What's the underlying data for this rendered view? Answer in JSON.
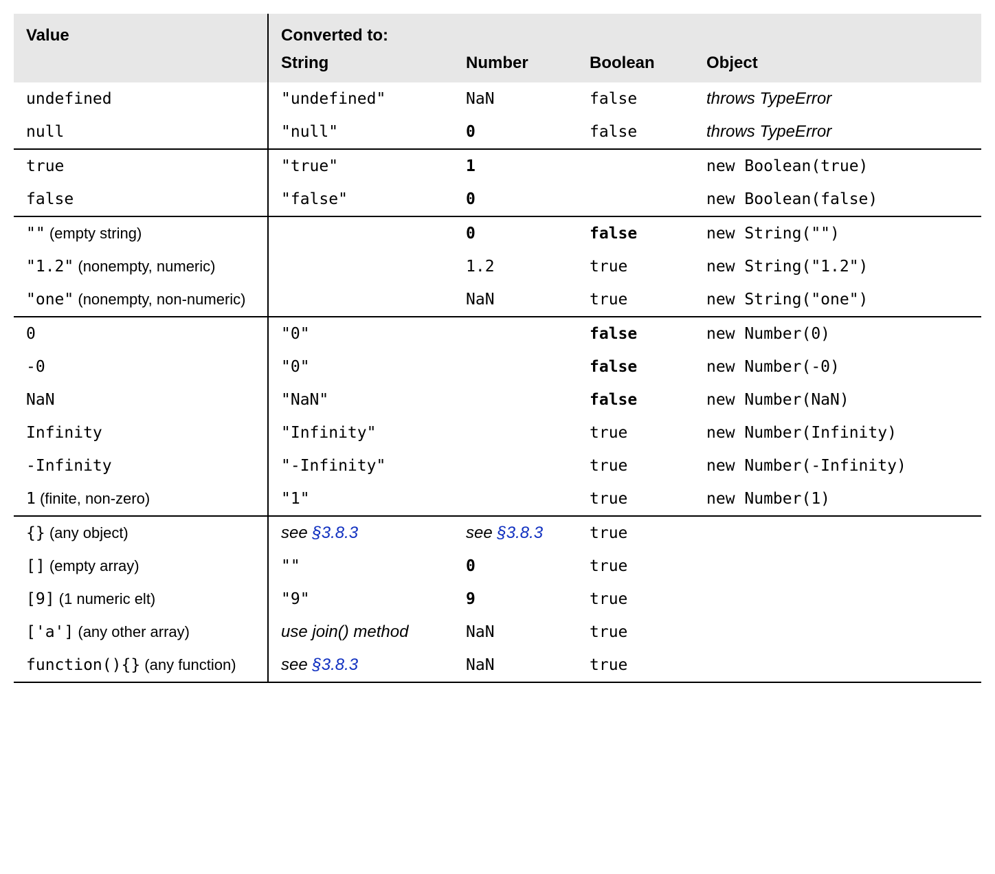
{
  "headers": {
    "value": "Value",
    "converted_to": "Converted to:",
    "string": "String",
    "number": "Number",
    "boolean": "Boolean",
    "object": "Object"
  },
  "groups": [
    {
      "rows": [
        {
          "value_code": "undefined",
          "value_note": "",
          "string": {
            "text": "\"undefined\"",
            "style": "mono"
          },
          "number": {
            "text": "NaN",
            "style": "mono"
          },
          "boolean": {
            "text": "false",
            "style": "mono"
          },
          "object": {
            "text": "throws TypeError",
            "style": "ital sans"
          }
        },
        {
          "value_code": "null",
          "value_note": "",
          "string": {
            "text": "\"null\"",
            "style": "mono"
          },
          "number": {
            "text": "0",
            "style": "mono bold"
          },
          "boolean": {
            "text": "false",
            "style": "mono"
          },
          "object": {
            "text": "throws TypeError",
            "style": "ital sans"
          }
        }
      ]
    },
    {
      "rows": [
        {
          "value_code": "true",
          "value_note": "",
          "string": {
            "text": "\"true\"",
            "style": "mono"
          },
          "number": {
            "text": "1",
            "style": "mono bold"
          },
          "boolean": {
            "text": "",
            "style": ""
          },
          "object": {
            "text": "new Boolean(true)",
            "style": "mono"
          }
        },
        {
          "value_code": "false",
          "value_note": "",
          "string": {
            "text": "\"false\"",
            "style": "mono"
          },
          "number": {
            "text": "0",
            "style": "mono bold"
          },
          "boolean": {
            "text": "",
            "style": ""
          },
          "object": {
            "text": "new Boolean(false)",
            "style": "mono"
          }
        }
      ]
    },
    {
      "rows": [
        {
          "value_code": "\"\"",
          "value_note": " (empty string)",
          "string": {
            "text": "",
            "style": ""
          },
          "number": {
            "text": "0",
            "style": "mono bold"
          },
          "boolean": {
            "text": "false",
            "style": "mono bold"
          },
          "object": {
            "text": "new String(\"\")",
            "style": "mono"
          }
        },
        {
          "value_code": "\"1.2\"",
          "value_note": " (nonempty, numeric)",
          "string": {
            "text": "",
            "style": ""
          },
          "number": {
            "text": "1.2",
            "style": "mono"
          },
          "boolean": {
            "text": "true",
            "style": "mono"
          },
          "object": {
            "text": "new String(\"1.2\")",
            "style": "mono"
          }
        },
        {
          "value_code": "\"one\"",
          "value_note": " (nonempty, non-numeric)",
          "string": {
            "text": "",
            "style": ""
          },
          "number": {
            "text": "NaN",
            "style": "mono"
          },
          "boolean": {
            "text": "true",
            "style": "mono"
          },
          "object": {
            "text": "new String(\"one\")",
            "style": "mono"
          }
        }
      ]
    },
    {
      "rows": [
        {
          "value_code": "0",
          "value_note": "",
          "string": {
            "text": "\"0\"",
            "style": "mono"
          },
          "number": {
            "text": "",
            "style": ""
          },
          "boolean": {
            "text": "false",
            "style": "mono bold"
          },
          "object": {
            "text": "new Number(0)",
            "style": "mono"
          }
        },
        {
          "value_code": "-0",
          "value_note": "",
          "string": {
            "text": "\"0\"",
            "style": "mono"
          },
          "number": {
            "text": "",
            "style": ""
          },
          "boolean": {
            "text": "false",
            "style": "mono bold"
          },
          "object": {
            "text": "new Number(-0)",
            "style": "mono"
          }
        },
        {
          "value_code": "NaN",
          "value_note": "",
          "string": {
            "text": "\"NaN\"",
            "style": "mono"
          },
          "number": {
            "text": "",
            "style": ""
          },
          "boolean": {
            "text": "false",
            "style": "mono bold"
          },
          "object": {
            "text": "new Number(NaN)",
            "style": "mono"
          }
        },
        {
          "value_code": "Infinity",
          "value_note": "",
          "string": {
            "text": "\"Infinity\"",
            "style": "mono"
          },
          "number": {
            "text": "",
            "style": ""
          },
          "boolean": {
            "text": "true",
            "style": "mono"
          },
          "object": {
            "text": "new Number(Infinity)",
            "style": "mono"
          }
        },
        {
          "value_code": "-Infinity",
          "value_note": "",
          "string": {
            "text": "\"-Infinity\"",
            "style": "mono"
          },
          "number": {
            "text": "",
            "style": ""
          },
          "boolean": {
            "text": "true",
            "style": "mono"
          },
          "object": {
            "text": "new Number(-Infinity)",
            "style": "mono"
          }
        },
        {
          "value_code": "1",
          "value_note": " (finite, non-zero)",
          "string": {
            "text": "\"1\"",
            "style": "mono"
          },
          "number": {
            "text": "",
            "style": ""
          },
          "boolean": {
            "text": "true",
            "style": "mono"
          },
          "object": {
            "text": "new Number(1)",
            "style": "mono"
          }
        }
      ]
    },
    {
      "rows": [
        {
          "value_code": "{}",
          "value_note": " (any object)",
          "string": {
            "prefix": "see ",
            "link": "§3.8.3",
            "style": "ital sans"
          },
          "number": {
            "prefix": "see ",
            "link": "§3.8.3",
            "style": "ital sans"
          },
          "boolean": {
            "text": "true",
            "style": "mono"
          },
          "object": {
            "text": "",
            "style": ""
          }
        },
        {
          "value_code": "[]",
          "value_note": " (empty array)",
          "string": {
            "text": "\"\"",
            "style": "mono"
          },
          "number": {
            "text": "0",
            "style": "mono bold"
          },
          "boolean": {
            "text": "true",
            "style": "mono"
          },
          "object": {
            "text": "",
            "style": ""
          }
        },
        {
          "value_code": "[9]",
          "value_note": " (1 numeric elt)",
          "string": {
            "text": "\"9\"",
            "style": "mono"
          },
          "number": {
            "text": "9",
            "style": "mono bold"
          },
          "boolean": {
            "text": "true",
            "style": "mono"
          },
          "object": {
            "text": "",
            "style": ""
          }
        },
        {
          "value_code": "['a']",
          "value_note": " (any other array)",
          "string": {
            "text": "use join() method",
            "style": "ital sans"
          },
          "number": {
            "text": "NaN",
            "style": "mono"
          },
          "boolean": {
            "text": "true",
            "style": "mono"
          },
          "object": {
            "text": "",
            "style": ""
          }
        },
        {
          "value_code": "function(){}",
          "value_note": " (any function)",
          "string": {
            "prefix": "see ",
            "link": "§3.8.3",
            "style": "ital sans"
          },
          "number": {
            "text": "NaN",
            "style": "mono"
          },
          "boolean": {
            "text": "true",
            "style": "mono"
          },
          "object": {
            "text": "",
            "style": ""
          }
        }
      ]
    }
  ]
}
